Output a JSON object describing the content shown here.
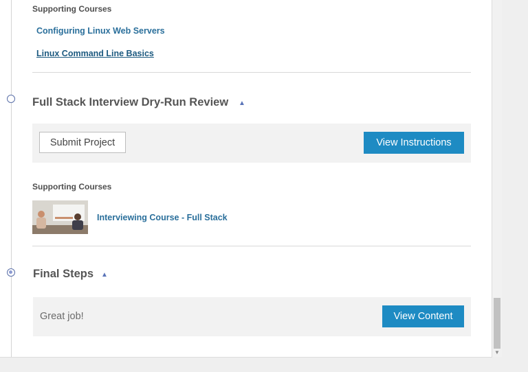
{
  "section1": {
    "supporting_label": "Supporting Courses",
    "courses": [
      "Configuring Linux Web Servers",
      "Linux Command Line Basics"
    ]
  },
  "project": {
    "title": "Full Stack Interview Dry-Run Review",
    "submit_label": "Submit Project",
    "instructions_label": "View Instructions",
    "supporting_label": "Supporting Courses",
    "course": "Interviewing Course - Full Stack"
  },
  "final": {
    "title": "Final Steps",
    "message": "Great job!",
    "button_label": "View Content"
  },
  "colors": {
    "primary_button": "#1e8bc3",
    "link": "#2a6f9b",
    "timeline_dot": "#5a6fa8"
  },
  "icons": {
    "collapse": "chevron-up-icon",
    "scroll_down": "scroll-down-arrow-icon"
  }
}
